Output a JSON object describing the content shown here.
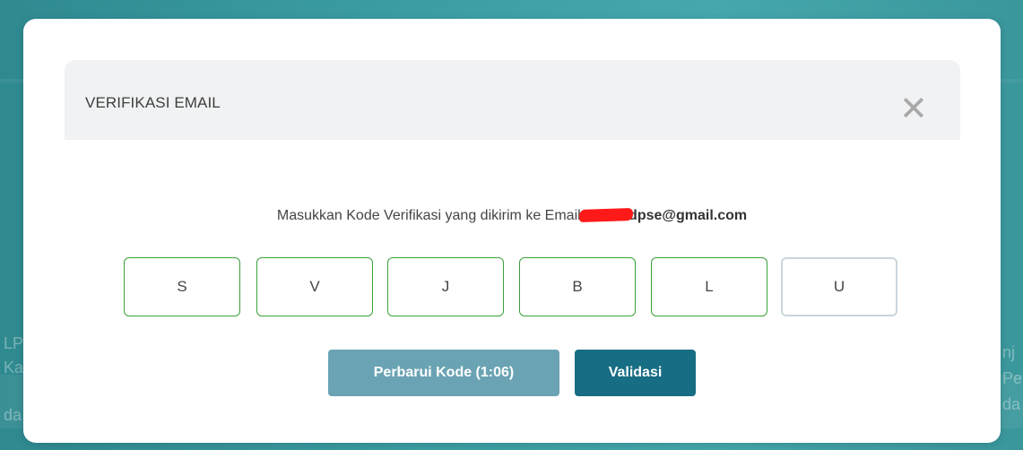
{
  "background": {
    "fragments_left": [
      "LP",
      "Ka",
      "da"
    ],
    "fragments_right": [
      "nj",
      "Pe",
      "da"
    ]
  },
  "modal": {
    "title": "VERIFIKASI EMAIL",
    "close_icon": "close-icon",
    "instruction_text": "Masukkan Kode Verifikasi yang dikirim ke Email",
    "email_visible": "dpse@gmail.com",
    "code_boxes": [
      {
        "value": "S"
      },
      {
        "value": "V"
      },
      {
        "value": "J"
      },
      {
        "value": "B"
      },
      {
        "value": "L"
      },
      {
        "value": "U"
      }
    ],
    "refresh_button_label": "Perbarui Kode (1:06)",
    "validate_button_label": "Validasi"
  },
  "colors": {
    "backdrop": "#3b9ea3",
    "box_border": "#3aa03a",
    "refresh_button": "#6aa3b3",
    "validate_button": "#176d83",
    "redaction": "#ff1a1a"
  }
}
